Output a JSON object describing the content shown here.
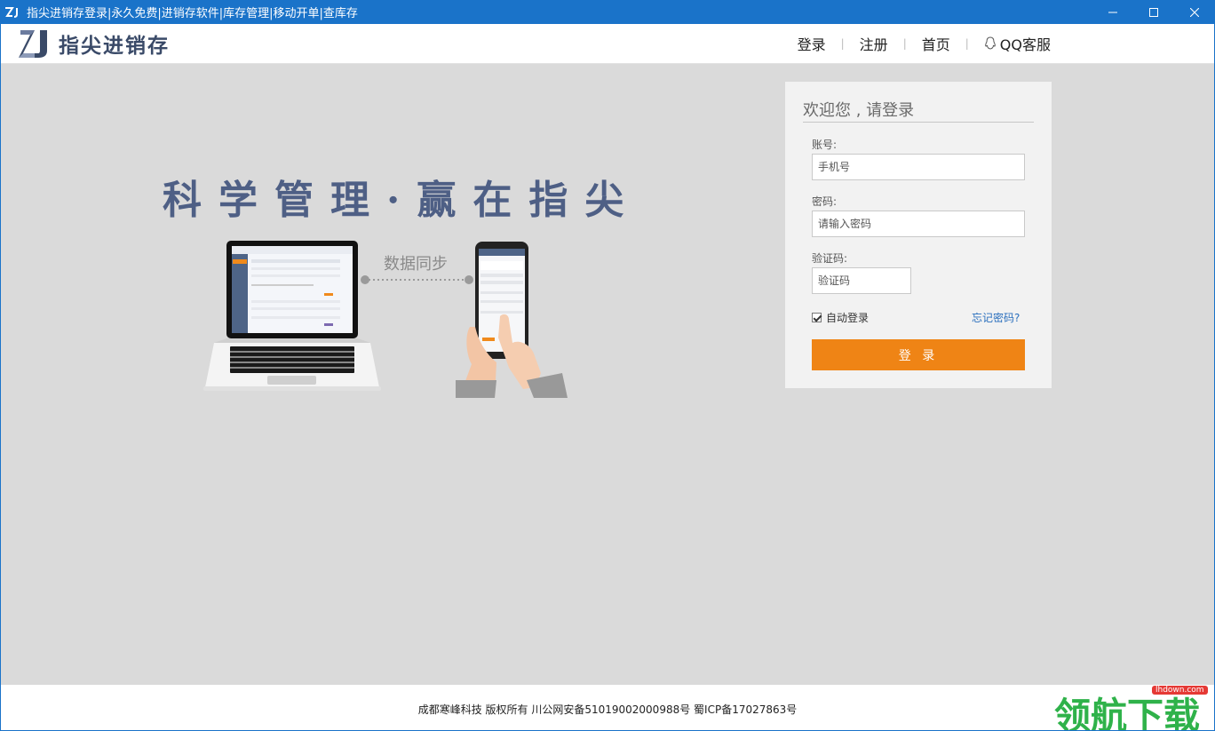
{
  "window": {
    "title": "指尖进销存登录|永久免费|进销存软件|库存管理|移动开单|查库存",
    "minimize_icon": "minimize-icon",
    "maximize_icon": "maximize-icon",
    "close_icon": "close-icon"
  },
  "header": {
    "logo_text": "指尖进销存",
    "nav": {
      "login": "登录",
      "register": "注册",
      "home": "首页",
      "qq_service": "QQ客服",
      "separator": "|"
    }
  },
  "hero": {
    "slogan": "科学管理·赢在指尖",
    "sync_label": "数据同步"
  },
  "login": {
    "title": "欢迎您 , 请登录",
    "account_label": "账号:",
    "account_placeholder": "手机号",
    "password_label": "密码:",
    "password_placeholder": "请输入密码",
    "captcha_label": "验证码:",
    "captcha_placeholder": "验证码",
    "auto_login_label": "自动登录",
    "auto_login_checked": true,
    "forgot_password": "忘记密码?",
    "submit": "登 录"
  },
  "footer": {
    "copyright": "成都寒峰科技 版权所有  川公网安备51019002000988号 蜀ICP备17027863号",
    "watermark_text": "领航下载",
    "watermark_url": "lhdown.com"
  },
  "colors": {
    "titlebar": "#1a73c9",
    "accent_orange": "#ef8415",
    "slogan": "#4e5f85",
    "background": "#dadada"
  }
}
